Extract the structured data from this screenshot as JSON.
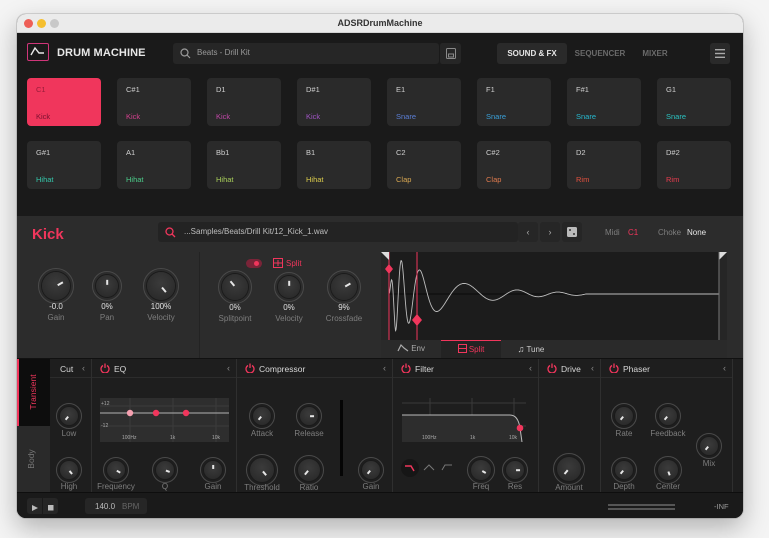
{
  "window": {
    "title": "ADSRDrumMachine",
    "traffic_lights": [
      "#ee5f57",
      "#f5bf2f",
      "#c8c8c8"
    ]
  },
  "colors": {
    "accent": "#f0365c",
    "text_dim": "#7e7e7e"
  },
  "header": {
    "logo_icon": "adsr-envelope-icon",
    "app_name": "DRUM MACHINE",
    "search_value": "Beats - Drill Kit",
    "search_icon": "search-icon",
    "save_icon": "save-icon",
    "tabs": [
      {
        "label": "SOUND & FX",
        "active": true
      },
      {
        "label": "SEQUENCER",
        "active": false
      },
      {
        "label": "MIXER",
        "active": false
      }
    ],
    "menu_icon": "hamburger-menu-icon"
  },
  "pads": [
    {
      "note": "C1",
      "name": "Kick",
      "color": "#7a1030",
      "selected": true
    },
    {
      "note": "C#1",
      "name": "Kick",
      "color": "#d4408e"
    },
    {
      "note": "D1",
      "name": "Kick",
      "color": "#c247a8"
    },
    {
      "note": "D#1",
      "name": "Kick",
      "color": "#a054c4"
    },
    {
      "note": "E1",
      "name": "Snare",
      "color": "#5b7fd6"
    },
    {
      "note": "F1",
      "name": "Snare",
      "color": "#3aa0d8"
    },
    {
      "note": "F#1",
      "name": "Snare",
      "color": "#26b9cf"
    },
    {
      "note": "G1",
      "name": "Snare",
      "color": "#2ac2c0"
    },
    {
      "note": "G#1",
      "name": "Hihat",
      "color": "#35c7ab"
    },
    {
      "note": "A1",
      "name": "Hihat",
      "color": "#4ccc8a"
    },
    {
      "note": "Bb1",
      "name": "Hihat",
      "color": "#a9cf5a"
    },
    {
      "note": "B1",
      "name": "Hihat",
      "color": "#dbcc4c"
    },
    {
      "note": "C2",
      "name": "Clap",
      "color": "#d9a852"
    },
    {
      "note": "C#2",
      "name": "Clap",
      "color": "#e07b4e"
    },
    {
      "note": "D2",
      "name": "Rim",
      "color": "#e4513f"
    },
    {
      "note": "D#2",
      "name": "Rim",
      "color": "#ea3c4f"
    }
  ],
  "instrument": {
    "name": "Kick",
    "sample_path": "...Samples/Beats/Drill Kit/12_Kick_1.wav",
    "prev_label": "‹",
    "next_label": "›",
    "random_icon": "dice-icon",
    "midi_label": "Midi",
    "midi_value": "C1",
    "choke_label": "Choke",
    "choke_value": "None",
    "main_knobs": [
      {
        "label": "Gain",
        "value": "-0.0"
      },
      {
        "label": "Pan",
        "value": "0%"
      },
      {
        "label": "Velocity",
        "value": "100%"
      }
    ],
    "split": {
      "enabled": true,
      "label": "Split",
      "knobs": [
        {
          "label": "Splitpoint",
          "value": "0%"
        },
        {
          "label": "Velocity",
          "value": "0%"
        },
        {
          "label": "Crossfade",
          "value": "9%"
        }
      ]
    },
    "wave_tabs": [
      {
        "label": "Env",
        "icon": "envelope-icon",
        "active": false
      },
      {
        "label": "Split",
        "icon": "split-icon",
        "active": true
      },
      {
        "label": "Tune",
        "icon": "music-note-icon",
        "active": false
      }
    ]
  },
  "layers": [
    {
      "label": "Transient",
      "active": true
    },
    {
      "label": "Body",
      "active": false
    }
  ],
  "fx": {
    "cut": {
      "title": "Cut",
      "knobs": [
        "Low",
        "High"
      ]
    },
    "eq": {
      "title": "EQ",
      "db_labels": [
        "+12",
        "-12"
      ],
      "freq_labels": [
        "100Hz",
        "1k",
        "10k"
      ],
      "knobs": [
        "Frequency",
        "Q",
        "Gain"
      ]
    },
    "compressor": {
      "title": "Compressor",
      "knobs": [
        "Attack",
        "Release",
        "Threshold",
        "Ratio",
        "Gain"
      ]
    },
    "filter": {
      "title": "Filter",
      "freq_labels": [
        "100Hz",
        "1k",
        "10k"
      ],
      "types": [
        "lowpass-icon",
        "bandpass-icon",
        "highpass-icon"
      ],
      "knobs": [
        "Freq",
        "Res"
      ]
    },
    "drive": {
      "title": "Drive",
      "knobs": [
        "Amount"
      ]
    },
    "phaser": {
      "title": "Phaser",
      "knobs": [
        "Rate",
        "Feedback",
        "Depth",
        "Center",
        "Mix"
      ]
    }
  },
  "transport": {
    "play_icon": "play-icon",
    "stop_icon": "stop-icon",
    "bpm_value": "140.0",
    "bpm_unit": "BPM",
    "level": "-INF"
  }
}
